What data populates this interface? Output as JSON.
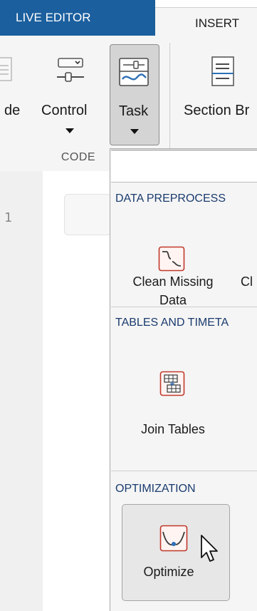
{
  "tabs": [
    {
      "label": "LIVE EDITOR"
    },
    {
      "label": "INSERT"
    }
  ],
  "toolstrip": {
    "partial_left_label": "de",
    "control_label": "Control",
    "task_label": "Task",
    "section_break_label": "Section Br",
    "group_label": "CODE"
  },
  "editor": {
    "line_number": "1"
  },
  "gallery": {
    "search_value": "",
    "sections": [
      {
        "title": "DATA PREPROCESS",
        "items": [
          {
            "label_line1": "Clean Missing",
            "label_line2": "Data",
            "icon": "clean-missing-data-icon"
          },
          {
            "label_line1": "Cl",
            "icon": ""
          }
        ]
      },
      {
        "title": "TABLES AND TIMETA",
        "items": [
          {
            "label_line1": "Join Tables",
            "icon": "join-tables-icon"
          }
        ]
      },
      {
        "title": "OPTIMIZATION",
        "items": [
          {
            "label_line1": "Optimize",
            "icon": "optimize-icon"
          }
        ]
      }
    ]
  },
  "colors": {
    "tab_active_bg": "#1b5f9e",
    "section_title": "#1a3b6e",
    "icon_red": "#c0392b"
  }
}
